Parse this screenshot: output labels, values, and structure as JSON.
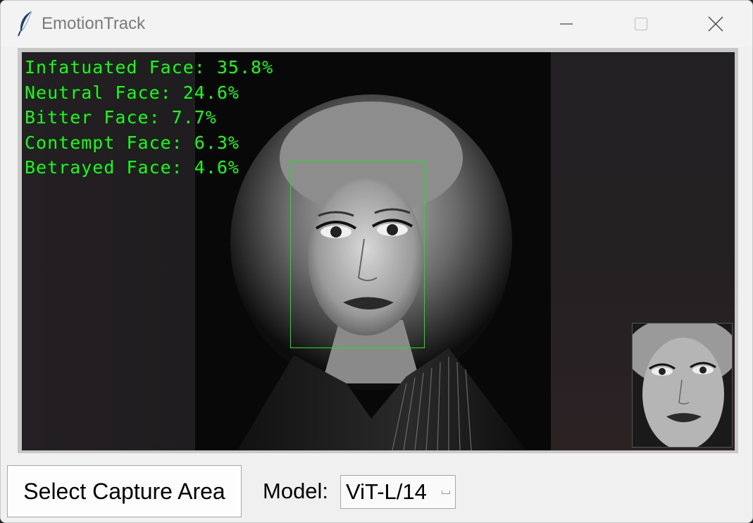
{
  "window": {
    "title": "EmotionTrack",
    "app_icon": "feather-icon",
    "controls": {
      "minimize_icon": "minimize-icon",
      "maximize_icon": "maximize-icon",
      "close_icon": "close-icon"
    }
  },
  "detections": {
    "emotions": [
      {
        "label": "Infatuated Face: 35.8%"
      },
      {
        "label": "Neutral Face: 24.6%"
      },
      {
        "label": "Bitter Face: 7.7%"
      },
      {
        "label": "Contempt Face: 6.3%"
      },
      {
        "label": "Betrayed Face: 4.6%"
      }
    ],
    "text_color": "#12ff12",
    "box_color": "#14e614"
  },
  "controls": {
    "select_button_label": "Select Capture Area",
    "model_label": "Model:",
    "model_value": "ViT-L/14"
  }
}
